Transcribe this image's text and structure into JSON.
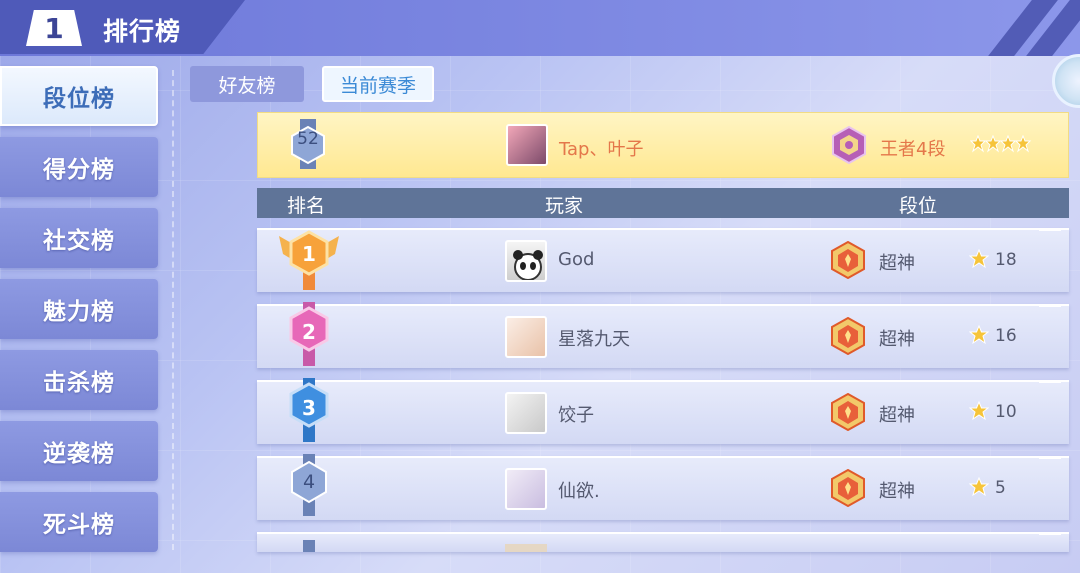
{
  "header": {
    "back_label": "1",
    "title": "排行榜"
  },
  "sidebar": {
    "items": [
      {
        "label": "段位榜",
        "active": true
      },
      {
        "label": "得分榜"
      },
      {
        "label": "社交榜"
      },
      {
        "label": "魅力榜"
      },
      {
        "label": "击杀榜"
      },
      {
        "label": "逆袭榜"
      },
      {
        "label": "死斗榜"
      }
    ]
  },
  "tabs": {
    "friends": "好友榜",
    "season": "当前赛季"
  },
  "my_rank": {
    "rank": "52",
    "name": "Tap、叶子",
    "tier": "王者4段"
  },
  "table": {
    "col_rank": "排名",
    "col_player": "玩家",
    "col_tier": "段位"
  },
  "rows": [
    {
      "rank": "1",
      "name": "God",
      "tier": "超神",
      "stars": "18"
    },
    {
      "rank": "2",
      "name": "星落九天",
      "tier": "超神",
      "stars": "16"
    },
    {
      "rank": "3",
      "name": "饺子",
      "tier": "超神",
      "stars": "10"
    },
    {
      "rank": "4",
      "name": "仙欲.",
      "tier": "超神",
      "stars": "5"
    }
  ],
  "colors": {
    "gold": "#f7a23a",
    "pink": "#e768b8",
    "blue": "#3f8fe0",
    "highlight": "#ffe891"
  }
}
